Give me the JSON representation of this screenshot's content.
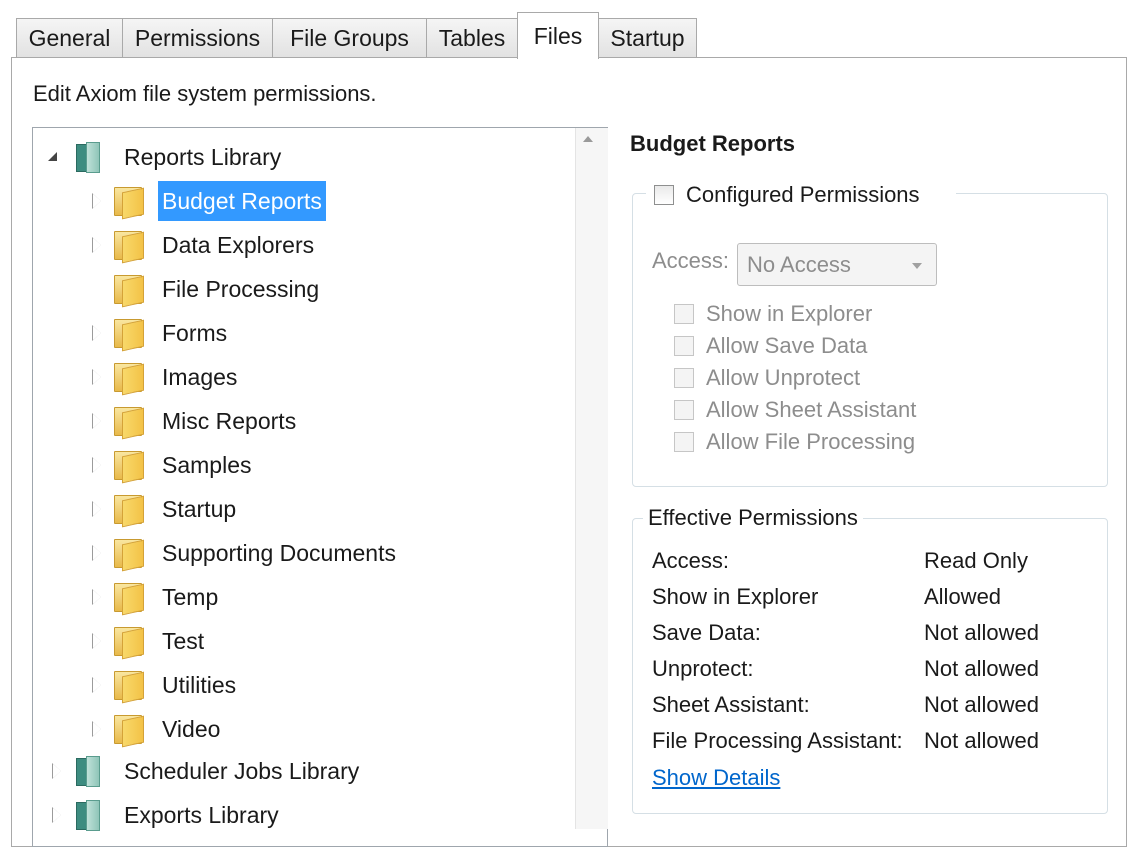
{
  "tabs": [
    {
      "label": "General"
    },
    {
      "label": "Permissions"
    },
    {
      "label": "File Groups"
    },
    {
      "label": "Tables"
    },
    {
      "label": "Files",
      "active": true
    },
    {
      "label": "Startup"
    }
  ],
  "description": "Edit Axiom file system permissions.",
  "tree": {
    "root": "Reports Library",
    "folders": [
      "Budget Reports",
      "Data Explorers",
      "File Processing",
      "Forms",
      "Images",
      "Misc Reports",
      "Samples",
      "Startup",
      "Supporting Documents",
      "Temp",
      "Test",
      "Utilities",
      "Video"
    ],
    "other_libraries": [
      "Scheduler Jobs Library",
      "Exports Library"
    ],
    "selected": "Budget Reports"
  },
  "details": {
    "title": "Budget Reports",
    "configured": {
      "legend": "Configured Permissions",
      "access_label": "Access:",
      "access_value": "No Access",
      "options": [
        "Show in Explorer",
        "Allow Save Data",
        "Allow Unprotect",
        "Allow Sheet Assistant",
        "Allow File Processing"
      ]
    },
    "effective": {
      "legend": "Effective Permissions",
      "rows": [
        {
          "key": "Access:",
          "value": "Read Only"
        },
        {
          "key": "Show in Explorer",
          "value": "Allowed"
        },
        {
          "key": "Save Data:",
          "value": "Not allowed"
        },
        {
          "key": "Unprotect:",
          "value": "Not allowed"
        },
        {
          "key": "Sheet Assistant:",
          "value": "Not allowed"
        },
        {
          "key": "File Processing Assistant:",
          "value": "Not allowed"
        }
      ],
      "link": "Show Details"
    }
  },
  "colors": {
    "selection": "#3399ff",
    "link": "#0066cc",
    "disabled_text": "#8d8d8d"
  }
}
